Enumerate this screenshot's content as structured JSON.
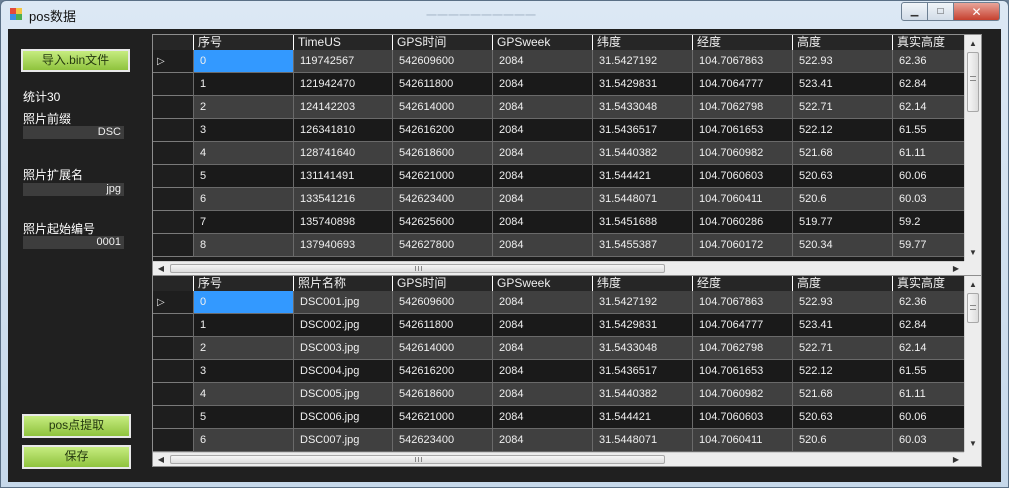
{
  "window": {
    "title": "pos数据",
    "ghost_title": "一一一一一一一一一一",
    "minimize_glyph": "▁",
    "maximize_glyph": "□",
    "close_glyph": "✕"
  },
  "left_panel": {
    "import_button": "导入.bin文件",
    "stat_label": "统计30",
    "photo_prefix_label": "照片前缀",
    "photo_prefix_value": "DSC",
    "photo_ext_label": "照片扩展名",
    "photo_ext_value": "jpg",
    "photo_start_label": "照片起始编号",
    "photo_start_value": "0001",
    "extract_button": "pos点提取",
    "save_button": "保存"
  },
  "grid_top": {
    "columns": [
      "序号",
      "TimeUS",
      "GPS时间",
      "GPSweek",
      "纬度",
      "经度",
      "高度",
      "真实高度"
    ],
    "rows": [
      [
        "0",
        "119742567",
        "542609600",
        "2084",
        "31.5427192",
        "104.7067863",
        "522.93",
        "62.36"
      ],
      [
        "1",
        "121942470",
        "542611800",
        "2084",
        "31.5429831",
        "104.7064777",
        "523.41",
        "62.84"
      ],
      [
        "2",
        "124142203",
        "542614000",
        "2084",
        "31.5433048",
        "104.7062798",
        "522.71",
        "62.14"
      ],
      [
        "3",
        "126341810",
        "542616200",
        "2084",
        "31.5436517",
        "104.7061653",
        "522.12",
        "61.55"
      ],
      [
        "4",
        "128741640",
        "542618600",
        "2084",
        "31.5440382",
        "104.7060982",
        "521.68",
        "61.11"
      ],
      [
        "5",
        "131141491",
        "542621000",
        "2084",
        "31.544421",
        "104.7060603",
        "520.63",
        "60.06"
      ],
      [
        "6",
        "133541216",
        "542623400",
        "2084",
        "31.5448071",
        "104.7060411",
        "520.6",
        "60.03"
      ],
      [
        "7",
        "135740898",
        "542625600",
        "2084",
        "31.5451688",
        "104.7060286",
        "519.77",
        "59.2"
      ],
      [
        "8",
        "137940693",
        "542627800",
        "2084",
        "31.5455387",
        "104.7060172",
        "520.34",
        "59.77"
      ]
    ]
  },
  "grid_bottom": {
    "columns": [
      "序号",
      "照片名称",
      "GPS时间",
      "GPSweek",
      "纬度",
      "经度",
      "高度",
      "真实高度"
    ],
    "rows": [
      [
        "0",
        "DSC001.jpg",
        "542609600",
        "2084",
        "31.5427192",
        "104.7067863",
        "522.93",
        "62.36"
      ],
      [
        "1",
        "DSC002.jpg",
        "542611800",
        "2084",
        "31.5429831",
        "104.7064777",
        "523.41",
        "62.84"
      ],
      [
        "2",
        "DSC003.jpg",
        "542614000",
        "2084",
        "31.5433048",
        "104.7062798",
        "522.71",
        "62.14"
      ],
      [
        "3",
        "DSC004.jpg",
        "542616200",
        "2084",
        "31.5436517",
        "104.7061653",
        "522.12",
        "61.55"
      ],
      [
        "4",
        "DSC005.jpg",
        "542618600",
        "2084",
        "31.5440382",
        "104.7060982",
        "521.68",
        "61.11"
      ],
      [
        "5",
        "DSC006.jpg",
        "542621000",
        "2084",
        "31.544421",
        "104.7060603",
        "520.63",
        "60.06"
      ],
      [
        "6",
        "DSC007.jpg",
        "542623400",
        "2084",
        "31.5448071",
        "104.7060411",
        "520.6",
        "60.03"
      ]
    ]
  },
  "glyphs": {
    "row_pointer": "▷",
    "scroll_up": "▲",
    "scroll_down": "▼",
    "scroll_left": "◀",
    "scroll_right": "▶"
  }
}
